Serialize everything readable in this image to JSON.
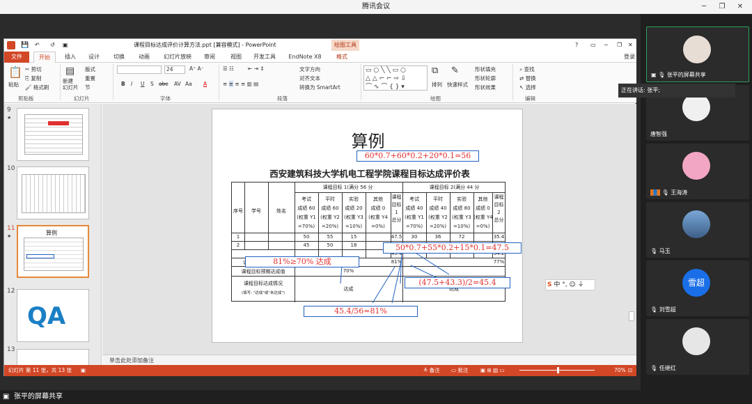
{
  "meeting": {
    "title": "腾讯会议",
    "share_label": "张平的屏幕共享",
    "speaking_label": "正在讲话: 张平;"
  },
  "ppt": {
    "file_title": "课程目标达成评价计算方法.ppt [兼容模式] - PowerPoint",
    "drawing_tools": "绘图工具",
    "login": "登录",
    "tabs": [
      "文件",
      "开始",
      "插入",
      "设计",
      "切换",
      "动画",
      "幻灯片放映",
      "审阅",
      "视图",
      "开发工具",
      "EndNote X8",
      "格式"
    ],
    "ribbon": {
      "paste": "粘贴",
      "cut": "剪切",
      "copy": "复制",
      "format_painter": "格式刷",
      "clipboard": "剪贴板",
      "new_slide": "新建\n幻灯片",
      "layout": "版式",
      "reset": "重置",
      "section": "节",
      "slides": "幻灯片",
      "font_size": "24",
      "font": "字体",
      "text_direction": "文字方向",
      "align_text": "对齐文本",
      "smartart": "转换为 SmartArt",
      "paragraph": "段落",
      "arrange": "排列",
      "quick_styles": "快速样式",
      "shape_fill": "形状填充",
      "shape_outline": "形状轮廓",
      "shape_effects": "形状效果",
      "drawing": "绘图",
      "find": "查找",
      "replace": "替换",
      "select": "选择",
      "editing": "编辑"
    },
    "slide_numbers": [
      "9",
      "10",
      "11",
      "12",
      "13"
    ],
    "notes_placeholder": "单击此处添加备注",
    "status": {
      "slide_info": "幻灯片 第 11 张，共 13 张",
      "notes": "备注",
      "comments": "批注",
      "zoom": "70%"
    }
  },
  "slide": {
    "heading": "算例",
    "formula_top": "60*0.7+60*0.2+20*0.1=56",
    "table_title": "西安建筑科技大学机电工程学院课程目标达成评价表",
    "group1": "课程目标 1(满分 56 分",
    "group2": "课程目标 2(满分 44 分",
    "col_seq": "序号",
    "col_id": "学号",
    "col_name": "姓名",
    "g1_cols": [
      "考试\n成绩 60\n(权重 Y1\n=70%)",
      "平时\n成绩 60\n(权重 Y2\n=20%)",
      "实验\n成绩 20\n(权重 Y3\n=10%)",
      "其他\n成绩 0\n(权重 Y4\n=0%)",
      "课程\n目标\n1\n总分"
    ],
    "g2_cols": [
      "考试\n成绩 40\n(权重 Y1\n=70%)",
      "平时\n成绩 40\n(权重 Y2\n=20%)",
      "实验\n成绩 80\n(权重 Y3\n=10%)",
      "其他\n成绩 0\n(权重 Y4\n=0%)",
      "课程\n目标\n2\n总分"
    ],
    "rows": [
      [
        "1",
        "",
        "",
        "50",
        "55",
        "15",
        "",
        "47.5",
        "30",
        "36",
        "72",
        "",
        "35.4"
      ],
      [
        "2",
        "",
        "",
        "45",
        "50",
        "18",
        "",
        "",
        "",
        "",
        "",
        "",
        "34.2"
      ]
    ],
    "row_goal": "课程目标 1 达成值",
    "row_expected": "课程目标预期达成值",
    "expected_value": "70%",
    "row_status": "课程目标达成情况",
    "row_status_note": "(填写: \"达成\"或\"未达成\")",
    "status_left": "达成",
    "status_right": "达成",
    "val_81": "81%",
    "val_77": "77%",
    "val_454": "45.4",
    "ann_formula2": "50*0.7+55*0.2+15*0.1=47.5",
    "ann_ge70": "81%≥70%  达成",
    "ann_avg": "(47.5+43.3)/2=45.4",
    "ann_ratio": "45.4/56=81%"
  },
  "participants": [
    {
      "name": "张平的屏幕共享",
      "avatar": "cat-photo"
    },
    {
      "name": "唐智强",
      "avatar": "white-blur"
    },
    {
      "name": "王海涛",
      "avatar": "cartoon-girl"
    },
    {
      "name": "马玉",
      "avatar": "landscape"
    },
    {
      "name": "刘雪超",
      "avatar": "text-avatar",
      "avatar_text": "雪超"
    },
    {
      "name": "任继红",
      "avatar": "bear-cartoon"
    }
  ],
  "colors": {
    "ppt_red": "#d24726",
    "annotation_red": "#e03030",
    "annotation_blue": "#2060c0",
    "avatar_blue": "#1a6fe8"
  }
}
